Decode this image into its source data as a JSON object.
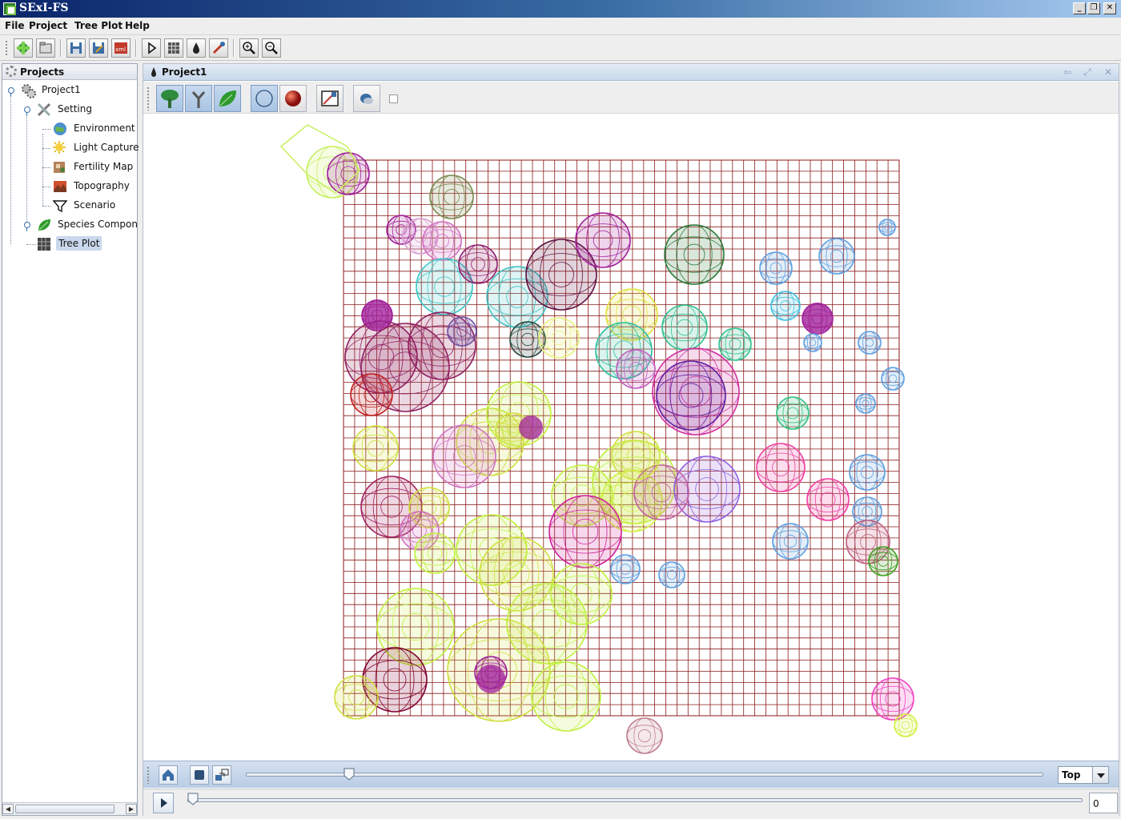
{
  "window": {
    "title": "SExI-FS",
    "buttons": [
      "_",
      "❐",
      "✕"
    ]
  },
  "menu": {
    "items": [
      "File",
      "Project",
      "Tree Plot",
      "Help"
    ]
  },
  "toolbar": {
    "icons": [
      "new-project-icon",
      "open-project-icon",
      "save-icon",
      "save-as-icon",
      "export-xml-icon",
      "play-icon",
      "grid-icon",
      "drop-icon",
      "edit-icon",
      "zoom-in-icon",
      "zoom-out-icon"
    ],
    "xml_label": "xml"
  },
  "projects_panel": {
    "title": "Projects",
    "tree": [
      {
        "label": "Project1",
        "icon": "project-gear-icon"
      },
      {
        "label": "Setting",
        "icon": "tools-icon"
      },
      {
        "label": "Environment",
        "icon": "globe-icon"
      },
      {
        "label": "Light Capture",
        "icon": "sun-icon"
      },
      {
        "label": "Fertility Map",
        "icon": "fertility-icon"
      },
      {
        "label": "Topography",
        "icon": "topography-icon"
      },
      {
        "label": "Scenario",
        "icon": "funnel-icon"
      },
      {
        "label": "Species Components",
        "icon": "leaf-icon"
      },
      {
        "label": "Tree Plot",
        "icon": "grid-icon"
      }
    ],
    "selected": "Tree Plot"
  },
  "main": {
    "tab_title": "Project1",
    "view_toolbar": [
      "tree-icon",
      "trunk-icon",
      "leaf-icon",
      "wireframe-sphere-icon",
      "solid-sphere-icon",
      "render-icon",
      "light-icon",
      "checkbox"
    ],
    "view_mode": "Top",
    "time_value": "0",
    "zoom_slider_fraction": 0.13,
    "time_slider_fraction": 0.0
  },
  "colors": {
    "grid": "#8b1a1a",
    "accent": "#3a6ea5",
    "header": "#c8d8eb"
  }
}
